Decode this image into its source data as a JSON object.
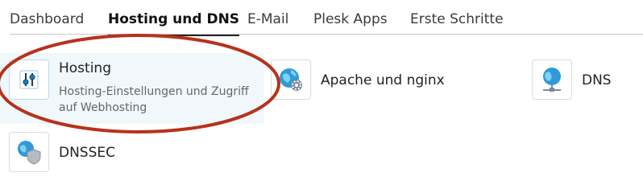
{
  "tabs": [
    {
      "label": "Dashboard",
      "active": false
    },
    {
      "label": "Hosting und DNS",
      "active": true
    },
    {
      "label": "E-Mail",
      "active": false
    },
    {
      "label": "Plesk Apps",
      "active": false
    },
    {
      "label": "Erste Schritte",
      "active": false
    }
  ],
  "tiles": {
    "hosting": {
      "title": "Hosting",
      "description": "Hosting-Einstellungen und Zugriff auf Webhosting",
      "icon": "sliders-icon"
    },
    "apache": {
      "title": "Apache und nginx",
      "icon": "globe-gear-icon"
    },
    "dns": {
      "title": "DNS",
      "icon": "globe-network-icon"
    },
    "dnssec": {
      "title": "DNSSEC",
      "icon": "globe-shield-icon"
    }
  },
  "colors": {
    "accent": "#0a85c9",
    "highlight_tile": "#f1f8fb",
    "annotation_oval": "#b7321c"
  }
}
